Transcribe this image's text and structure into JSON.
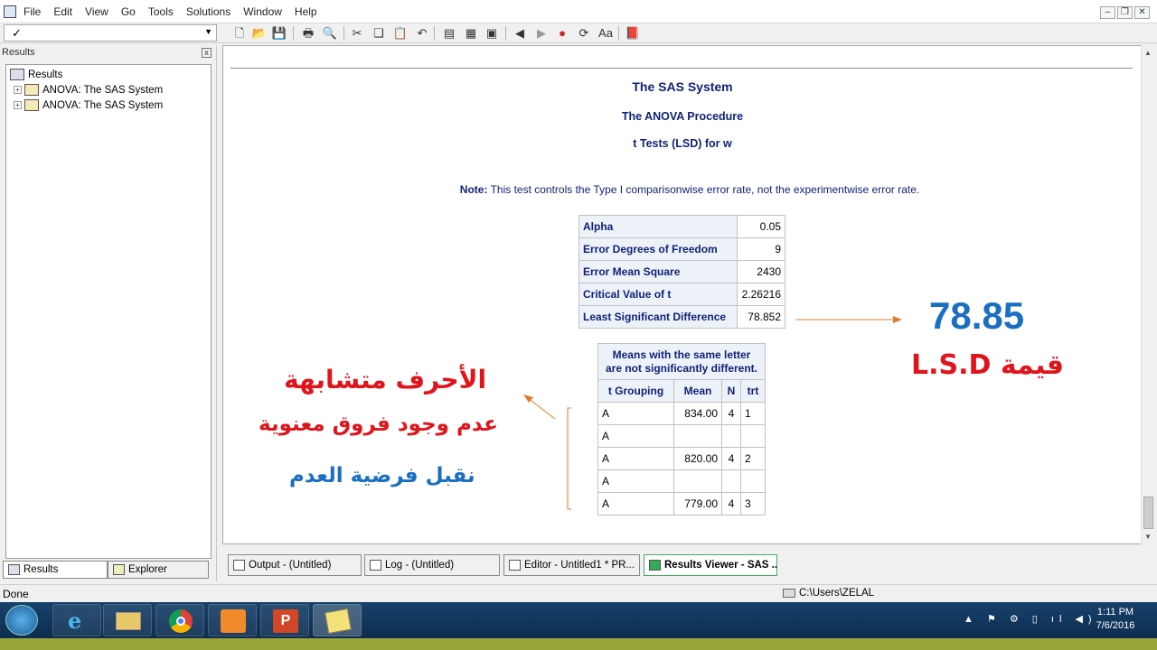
{
  "menubar": {
    "items": [
      "File",
      "Edit",
      "View",
      "Go",
      "Tools",
      "Solutions",
      "Window",
      "Help"
    ]
  },
  "results_pane": {
    "header": "Results",
    "tree_root": "Results",
    "tree_items": [
      "ANOVA:  The SAS System",
      "ANOVA:  The SAS System"
    ],
    "tabs": [
      "Results",
      "Explorer"
    ]
  },
  "report": {
    "title": "The SAS System",
    "procedure": "The ANOVA Procedure",
    "subtitle": "t Tests (LSD) for w",
    "note_label": "Note:",
    "note_text": " This test controls the Type I comparisonwise error rate, not the experimentwise error rate.",
    "stats": [
      {
        "label": "Alpha",
        "value": "0.05"
      },
      {
        "label": "Error Degrees of Freedom",
        "value": "9"
      },
      {
        "label": "Error Mean Square",
        "value": "2430"
      },
      {
        "label": "Critical Value of t",
        "value": "2.26216"
      },
      {
        "label": "Least Significant Difference",
        "value": "78.852"
      }
    ],
    "means_caption_1": "Means with the same letter",
    "means_caption_2": "are not significantly different.",
    "means_headers": [
      "t Grouping",
      "Mean",
      "N",
      "trt"
    ],
    "means_rows": [
      {
        "group": "A",
        "mean": "834.00",
        "n": "4",
        "trt": "1"
      },
      {
        "group": "A",
        "mean": "",
        "n": "",
        "trt": ""
      },
      {
        "group": "A",
        "mean": "820.00",
        "n": "4",
        "trt": "2"
      },
      {
        "group": "A",
        "mean": "",
        "n": "",
        "trt": ""
      },
      {
        "group": "A",
        "mean": "779.00",
        "n": "4",
        "trt": "3"
      }
    ]
  },
  "annotations": {
    "lsd_value": "78.85",
    "lsd_label": "قيمة L.S.D",
    "line1": "الأحرف متشابهة",
    "line2": "عدم وجود فروق معنوية",
    "line3": "نقبل فرضية العدم",
    "colors": {
      "red": "#e0151b",
      "blue": "#1a6fc2",
      "arrow": "#e07b2a"
    }
  },
  "window_tabs": [
    {
      "label": "Output - (Untitled)"
    },
    {
      "label": "Log - (Untitled)"
    },
    {
      "label": "Editor - Untitled1 *   PR..."
    },
    {
      "label": "Results Viewer - SAS ..."
    }
  ],
  "status": {
    "left": "Done",
    "path": "C:\\Users\\ZELAL"
  },
  "taskbar": {
    "time": "1:11 PM",
    "date": "7/6/2016"
  }
}
